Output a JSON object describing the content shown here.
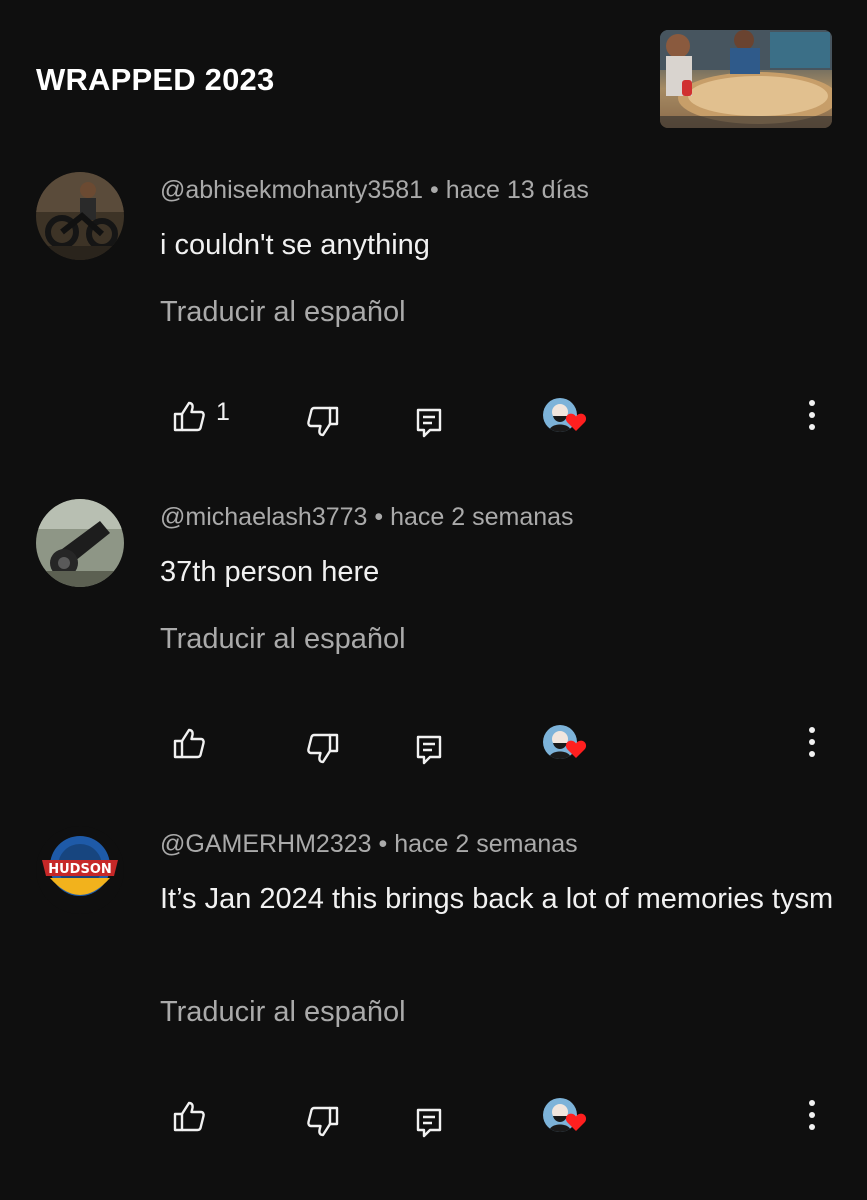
{
  "header": {
    "title": "WRAPPED 2023",
    "thumbnail_icon": "video-thumbnail"
  },
  "translate_label": "Traducir al español",
  "comments": [
    {
      "author": "@abhisekmohanty3581",
      "time": "hace 13 días",
      "text": "i couldn't se anything",
      "likes": "1",
      "avatar_icon": "motorcycle-rider-avatar"
    },
    {
      "author": "@michaelash3773",
      "time": "hace 2 semanas",
      "text": "37th person here",
      "likes": "",
      "avatar_icon": "cannon-avatar"
    },
    {
      "author": "@GAMERHM2323",
      "time": "hace 2 semanas",
      "text": "It’s Jan 2024 this brings back a lot of memories tysm",
      "likes": "",
      "avatar_icon": "hudson-badge-avatar",
      "avatar_badge_text": "HUDSON"
    }
  ],
  "colors": {
    "background": "#0f0f0f",
    "text": "#f1f1f1",
    "secondary_text": "#aaaaaa",
    "heart": "#ff1f1f"
  }
}
